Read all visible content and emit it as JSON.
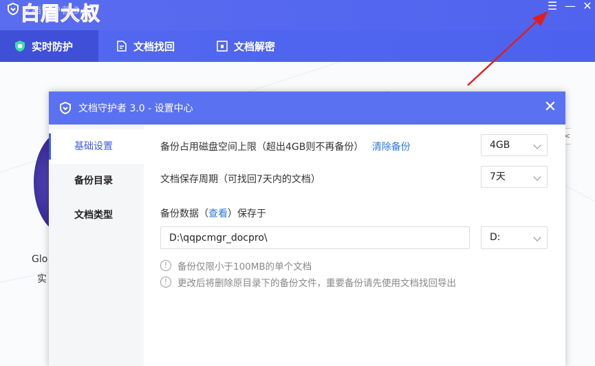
{
  "app": {
    "title": "文档守护者 3.0",
    "watermark": "白眉大叔",
    "controls": {
      "menu": "☰",
      "minimize": "—",
      "close": "✕"
    }
  },
  "nav": {
    "tabs": [
      {
        "label": "实时防护",
        "icon": "shield-icon",
        "active": true
      },
      {
        "label": "文档找回",
        "icon": "document-recover-icon",
        "active": false
      },
      {
        "label": "文档解密",
        "icon": "document-decrypt-icon",
        "active": false
      }
    ]
  },
  "background": {
    "text1": "Glo",
    "text2": "实",
    "right_tab": "<"
  },
  "dialog": {
    "title": "文档守护者 3.0 - 设置中心",
    "close": "✕",
    "sidebar": [
      {
        "label": "基础设置",
        "active": true
      },
      {
        "label": "备份目录",
        "active": false
      },
      {
        "label": "文档类型",
        "active": false
      }
    ],
    "backup_limit": {
      "label": "备份占用磁盘空间上限（超出4GB则不再备份）",
      "link": "清除备份",
      "value": "4GB"
    },
    "retention": {
      "label": "文档保存周期（可找回7天内的文档）",
      "value": "7天"
    },
    "backup_location": {
      "label_prefix": "备份数据（",
      "link": "查看",
      "label_suffix": "）保存于",
      "path": "D:\\qqpcmgr_docpro\\",
      "drive": "D:"
    },
    "notes": [
      "备份仅限小于100MB的单个文档",
      "更改后将删除原目录下的备份文件，重要备份请先使用文档找回导出"
    ]
  },
  "colors": {
    "titlebar": "#5a6cf0",
    "dialog_header": "#5a72f2",
    "accent": "#3b5ce8",
    "link": "#2a78e0",
    "arrow": "#e11d1d"
  }
}
